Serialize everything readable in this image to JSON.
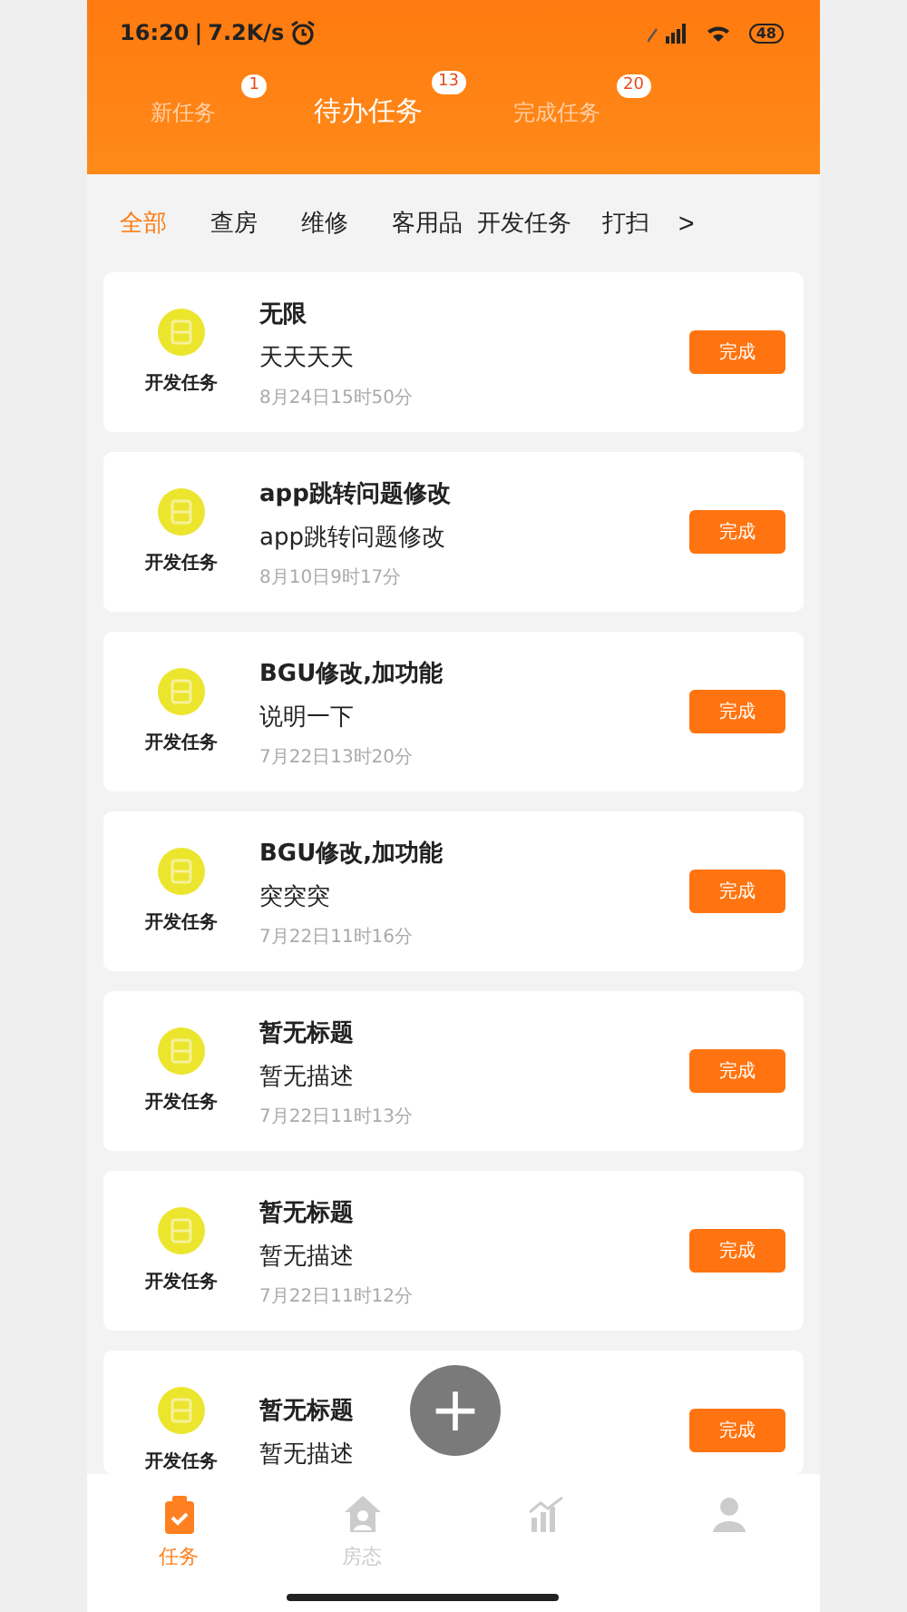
{
  "status_bar": {
    "time": "16:20",
    "divider": "|",
    "speed": "7.2K/s",
    "battery": "48"
  },
  "tabs": [
    {
      "label": "新任务",
      "badge": "1",
      "selected": false
    },
    {
      "label": "待办任务",
      "badge": "13",
      "selected": true
    },
    {
      "label": "完成任务",
      "badge": "20",
      "selected": false
    }
  ],
  "categories": [
    {
      "label": "全部",
      "selected": true
    },
    {
      "label": "查房",
      "selected": false
    },
    {
      "label": "维修",
      "selected": false
    },
    {
      "label": "客用品",
      "selected": false
    },
    {
      "label": "开发任务",
      "selected": false
    },
    {
      "label": "打扫",
      "selected": false
    }
  ],
  "more_arrow": ">",
  "tasks": [
    {
      "type": "开发任务",
      "title": "无限",
      "description": "天天天天",
      "time": "8月24日15时50分",
      "action": "完成"
    },
    {
      "type": "开发任务",
      "title": "app跳转问题修改",
      "description": "app跳转问题修改",
      "time": "8月10日9时17分",
      "action": "完成"
    },
    {
      "type": "开发任务",
      "title": "BGU修改,加功能",
      "description": "说明一下",
      "time": "7月22日13时20分",
      "action": "完成"
    },
    {
      "type": "开发任务",
      "title": "BGU修改,加功能",
      "description": "突突突",
      "time": "7月22日11时16分",
      "action": "完成"
    },
    {
      "type": "开发任务",
      "title": "暂无标题",
      "description": "暂无描述",
      "time": "7月22日11时13分",
      "action": "完成"
    },
    {
      "type": "开发任务",
      "title": "暂无标题",
      "description": "暂无描述",
      "time": "7月22日11时12分",
      "action": "完成"
    },
    {
      "type": "开发任务",
      "title": "暂无标题",
      "description": "暂无描述",
      "action": "完成"
    }
  ],
  "fab": "+",
  "nav": [
    {
      "kind": "tasks",
      "label": "任务",
      "selected": true
    },
    {
      "kind": "rooms",
      "label": "房态",
      "selected": false
    },
    {
      "kind": "report",
      "selected": false
    },
    {
      "kind": "profile",
      "selected": false
    }
  ]
}
